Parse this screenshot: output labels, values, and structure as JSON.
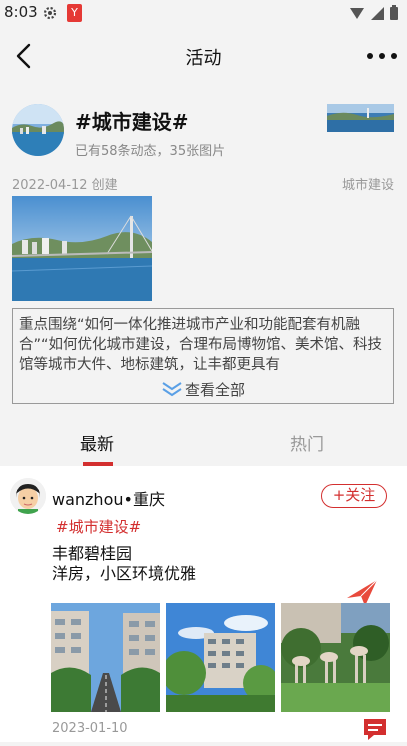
{
  "status_bar": {
    "time": "8:03"
  },
  "navbar": {
    "title": "活动"
  },
  "topic": {
    "title": "#城市建设#",
    "subtitle": "已有58条动态，35张图片",
    "date": "2022-04-12 创建",
    "category": "城市建设",
    "description": "重点围绕“如何一体化推进城市产业和功能配套有机融合”“如何优化城市建设，合理布局博物馆、美术馆、科技馆等城市大件、地标建筑，让丰都更具有",
    "see_all_label": "查看全部"
  },
  "tabs": [
    {
      "label": "最新",
      "active": true
    },
    {
      "label": "热门",
      "active": false
    }
  ],
  "post": {
    "author": "wanzhou•重庆",
    "follow_label": "关注",
    "tag": "#城市建设#",
    "line1": "丰都碧桂园",
    "line2": "洋房，小区环境优雅",
    "date": "2023-01-10"
  },
  "colors": {
    "accent": "#d32f2f",
    "background": "#f3f3f3"
  }
}
